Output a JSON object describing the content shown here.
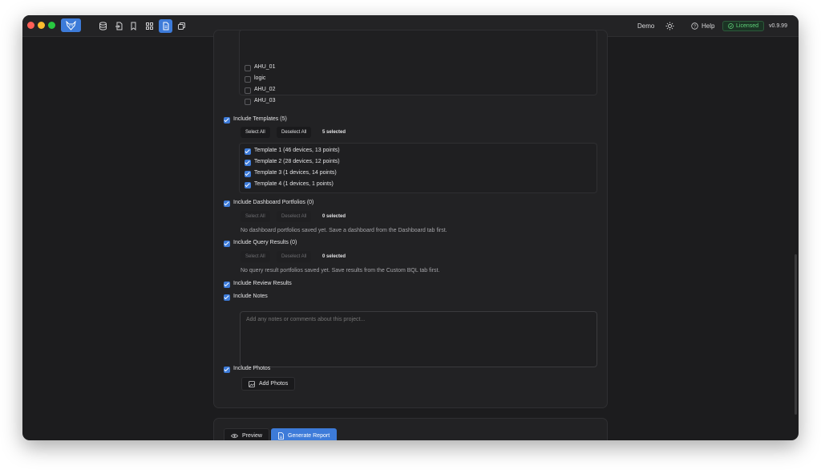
{
  "titlebar": {
    "workspace": "Demo",
    "help_label": "Help",
    "license_label": "Licensed",
    "version": "v0.9.99",
    "tool_icons": [
      "database-icon",
      "file-import-icon",
      "bookmark-icon",
      "grid-icon",
      "report-icon",
      "copy-icon"
    ]
  },
  "sections": {
    "sites": {
      "items": [
        "AHU_01",
        "logic",
        "AHU_02",
        "AHU_03"
      ]
    },
    "templates": {
      "label": "Include Templates (5)",
      "select_all": "Select All",
      "deselect_all": "Deselect All",
      "count": "5 selected",
      "items": [
        "Template 1 (46 devices, 13 points)",
        "Template 2 (28 devices, 12 points)",
        "Template 3 (1 devices, 14 points)",
        "Template 4 (1 devices, 1 points)"
      ]
    },
    "dashboards": {
      "label": "Include Dashboard Portfolios (0)",
      "select_all": "Select All",
      "deselect_all": "Deselect All",
      "count": "0 selected",
      "empty": "No dashboard portfolios saved yet. Save a dashboard from the Dashboard tab first."
    },
    "queries": {
      "label": "Include Query Results (0)",
      "select_all": "Select All",
      "deselect_all": "Deselect All",
      "count": "0 selected",
      "empty": "No query result portfolios saved yet. Save results from the Custom BQL tab first."
    },
    "review": {
      "label": "Include Review Results"
    },
    "notes": {
      "label": "Include Notes",
      "placeholder": "Add any notes or comments about this project..."
    },
    "photos": {
      "label": "Include Photos",
      "add_label": "Add Photos"
    }
  },
  "footer": {
    "preview_label": "Preview",
    "generate_label": "Generate Report"
  },
  "colors": {
    "accent": "#3d7bd9",
    "background": "#1c1c1e",
    "card": "#222224",
    "licensed": "#5fd37a"
  }
}
